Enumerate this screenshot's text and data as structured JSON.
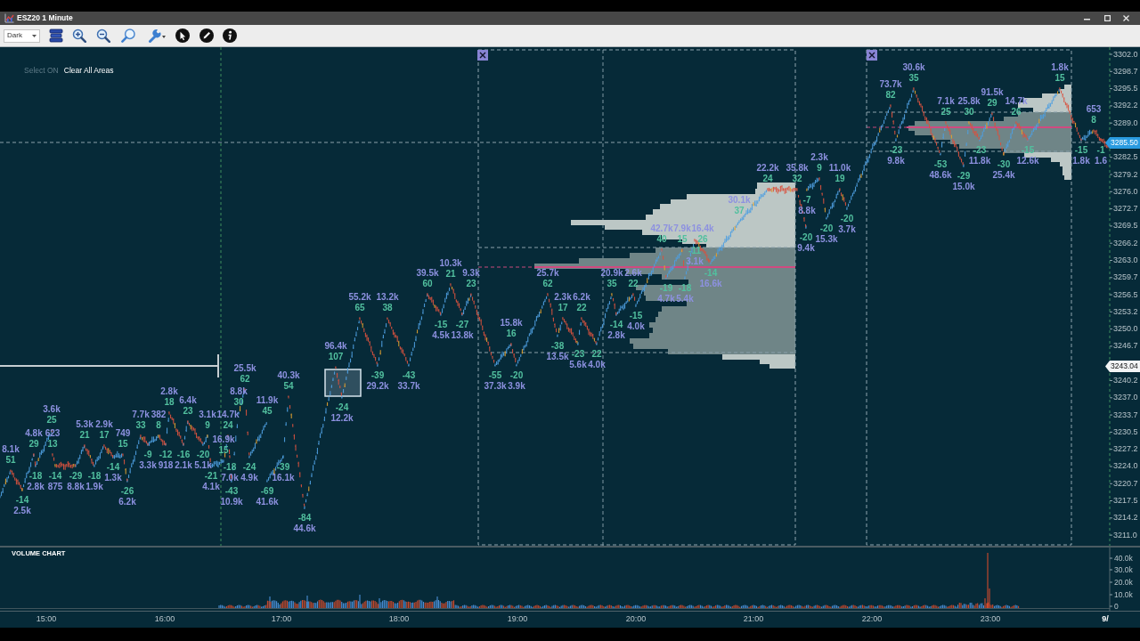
{
  "window": {
    "title": "ESZ20 1 Minute"
  },
  "toolbar": {
    "theme_select": {
      "value": "Dark"
    }
  },
  "chart": {
    "area_controls": [
      {
        "label": "Select ON",
        "disabled": true
      },
      {
        "label": "Clear All Areas",
        "disabled": false
      }
    ],
    "swing_highs": [
      {
        "volume": "30.6k",
        "delta": "35"
      },
      {
        "volume": "1.8k",
        "delta": "15"
      },
      {
        "volume": "73.7k",
        "delta": "82"
      },
      {
        "volume": "91.5k",
        "delta": "29"
      },
      {
        "volume": "7.1k",
        "delta": "25"
      },
      {
        "volume": "25.8k",
        "delta": "30"
      },
      {
        "volume": "14.7k",
        "delta": "26"
      },
      {
        "volume": "653",
        "delta": "8"
      },
      {
        "volume": "2.3k",
        "delta": "9"
      },
      {
        "volume": "22.2k",
        "delta": "24"
      },
      {
        "volume": "35.8k",
        "delta": "32"
      },
      {
        "volume": "11.0k",
        "delta": "19"
      },
      {
        "volume": "30.1k",
        "delta": "37"
      },
      {
        "volume": "42.7k",
        "delta": "40"
      },
      {
        "volume": "7.9k",
        "delta": "15"
      },
      {
        "volume": "16.4k",
        "delta": "26"
      },
      {
        "volume": "10.3k",
        "delta": "21"
      },
      {
        "volume": "39.5k",
        "delta": "60"
      },
      {
        "volume": "9.3k",
        "delta": "23"
      },
      {
        "volume": "25.7k",
        "delta": "62"
      },
      {
        "volume": "20.9k",
        "delta": "35"
      },
      {
        "volume": "2.6k",
        "delta": "22"
      },
      {
        "volume": "55.2k",
        "delta": "65"
      },
      {
        "volume": "13.2k",
        "delta": "38"
      },
      {
        "volume": "2.3k",
        "delta": "17"
      },
      {
        "volume": "6.2k",
        "delta": "22"
      },
      {
        "volume": "15.8k",
        "delta": "16"
      },
      {
        "volume": "96.4k",
        "delta": "107"
      },
      {
        "volume": "25.5k",
        "delta": "62"
      },
      {
        "volume": "40.3k",
        "delta": "54"
      },
      {
        "volume": "2.8k",
        "delta": "18"
      },
      {
        "volume": "8.8k",
        "delta": "30"
      },
      {
        "volume": "6.4k",
        "delta": "23"
      },
      {
        "volume": "11.9k",
        "delta": "45"
      },
      {
        "volume": "3.6k",
        "delta": "25"
      },
      {
        "volume": "7.7k",
        "delta": "33"
      },
      {
        "volume": "382",
        "delta": "8"
      },
      {
        "volume": "3.1k",
        "delta": "9"
      },
      {
        "volume": "14.7k",
        "delta": "24"
      },
      {
        "volume": "5.3k",
        "delta": "21"
      },
      {
        "volume": "2.9k",
        "delta": "17"
      },
      {
        "volume": "4.8k",
        "delta": "29"
      },
      {
        "volume": "623",
        "delta": "13"
      },
      {
        "volume": "749",
        "delta": "15"
      },
      {
        "volume": "16.9k",
        "delta": "15"
      },
      {
        "volume": "8.1k",
        "delta": "51"
      }
    ],
    "swing_lows": [
      {
        "delta": "-23",
        "volume": "9.8k"
      },
      {
        "delta": "-23",
        "volume": "11.8k"
      },
      {
        "delta": "-15",
        "volume": "12.6k"
      },
      {
        "delta": "-15",
        "volume": "1.8k"
      },
      {
        "delta": "-1",
        "volume": "1.6"
      },
      {
        "delta": "-53",
        "volume": "48.6k"
      },
      {
        "delta": "-30",
        "volume": "25.4k"
      },
      {
        "delta": "-29",
        "volume": "15.0k"
      },
      {
        "delta": "-7",
        "volume": "8.8k"
      },
      {
        "delta": "-20",
        "volume": "3.7k"
      },
      {
        "delta": "-20",
        "volume": "15.3k"
      },
      {
        "delta": "-20",
        "volume": "9.4k"
      },
      {
        "delta": "-11",
        "volume": "3.1k"
      },
      {
        "delta": "-14",
        "volume": "16.6k"
      },
      {
        "delta": "-19",
        "volume": "4.7k"
      },
      {
        "delta": "-18",
        "volume": "5.4k"
      },
      {
        "delta": "-15",
        "volume": "4.0k"
      },
      {
        "delta": "-15",
        "volume": "4.5k"
      },
      {
        "delta": "-27",
        "volume": "13.8k"
      },
      {
        "delta": "-14",
        "volume": "2.8k"
      },
      {
        "delta": "-38",
        "volume": "13.5k"
      },
      {
        "delta": "-23",
        "volume": "5.6k"
      },
      {
        "delta": "22",
        "volume": "4.0k"
      },
      {
        "delta": "-39",
        "volume": "29.2k"
      },
      {
        "delta": "-43",
        "volume": "33.7k"
      },
      {
        "delta": "-55",
        "volume": "37.3k"
      },
      {
        "delta": "-20",
        "volume": "3.9k"
      },
      {
        "delta": "-24",
        "volume": "12.2k"
      },
      {
        "delta": "-9",
        "volume": "3.3k"
      },
      {
        "delta": "-12",
        "volume": "918"
      },
      {
        "delta": "-16",
        "volume": "2.1k"
      },
      {
        "delta": "-20",
        "volume": "5.1k"
      },
      {
        "delta": "-14",
        "volume": "1.3k"
      },
      {
        "delta": "-18",
        "volume": "7.0k"
      },
      {
        "delta": "-24",
        "volume": "4.9k"
      },
      {
        "delta": "-39",
        "volume": "16.1k"
      },
      {
        "delta": "-18",
        "volume": "2.8k"
      },
      {
        "delta": "-14",
        "volume": "875"
      },
      {
        "delta": "-29",
        "volume": "8.8k"
      },
      {
        "delta": "-18",
        "volume": "1.9k"
      },
      {
        "delta": "-21",
        "volume": "4.1k"
      },
      {
        "delta": "-26",
        "volume": "6.2k"
      },
      {
        "delta": "-43",
        "volume": "10.9k"
      },
      {
        "delta": "-69",
        "volume": "41.6k"
      },
      {
        "delta": "-14",
        "volume": "2.5k"
      },
      {
        "delta": "-84",
        "volume": "44.6k"
      }
    ],
    "price_axis": [
      "3302.0",
      "3298.7",
      "3295.5",
      "3292.2",
      "3289.0",
      "3282.5",
      "3279.2",
      "3276.0",
      "3272.7",
      "3269.5",
      "3266.2",
      "3263.0",
      "3259.7",
      "3256.5",
      "3253.2",
      "3250.0",
      "3246.7",
      "3240.2",
      "3237.0",
      "3233.7",
      "3230.5",
      "3227.2",
      "3224.0",
      "3220.7",
      "3217.5",
      "3214.2",
      "3211.0"
    ],
    "price_markers": [
      {
        "kind": "last",
        "label": "3285.50"
      },
      {
        "kind": "line",
        "label": "3243.04"
      }
    ]
  },
  "volume_chart": {
    "title": "VOLUME CHART",
    "axis_labels": [
      "40.0k",
      "30.0k",
      "20.0k",
      "10.0k",
      "0"
    ]
  },
  "time_axis": [
    {
      "kind": "time",
      "label": "15:00"
    },
    {
      "kind": "time",
      "label": "16:00"
    },
    {
      "kind": "time",
      "label": "17:00"
    },
    {
      "kind": "time",
      "label": "18:00"
    },
    {
      "kind": "time",
      "label": "19:00"
    },
    {
      "kind": "time",
      "label": "20:00"
    },
    {
      "kind": "time",
      "label": "21:00"
    },
    {
      "kind": "time",
      "label": "22:00"
    },
    {
      "kind": "time",
      "label": "23:00"
    },
    {
      "kind": "date",
      "label": "9/"
    }
  ]
}
